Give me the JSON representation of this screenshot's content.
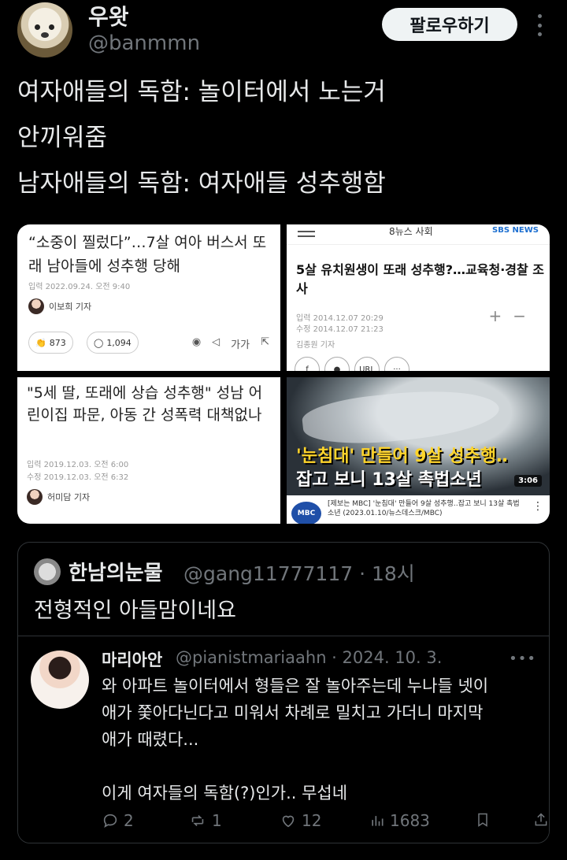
{
  "tweet": {
    "author_name": "우왓",
    "author_handle": "@banmmn",
    "follow_label": "팔로우하기",
    "lines": [
      "여자애들의 독함: 놀이터에서 노는거",
      "안끼워줌",
      "남자애들의 독함: 여자애들 성추행함"
    ]
  },
  "media": {
    "tile1": {
      "headline": "“소중이 찔렀다”…7살 여아 버스서 또래 남아들에 성추행 당해",
      "date": "입력 2022.09.24. 오전 9:40",
      "reporter": "이보희 기자",
      "reactions": "873",
      "comments": "1,094",
      "font_label": "가가"
    },
    "tile2": {
      "section": "8뉴스  사회",
      "logo": "SBS NEWS",
      "headline": "5살 유치원생이 또래 성추행?…교육청·경찰 조사",
      "date_input": "입력 2014.12.07 20:29",
      "date_modified": "수정 2014.12.07 21:23",
      "reporter": "김종원 기자",
      "share_url": "URL"
    },
    "tile3": {
      "headline": "\"5세 딸, 또래에 상습 성추행\" 성남 어린이집 파문, 아동 간 성폭력 대책없나",
      "date_input": "입력 2019.12.03. 오전 6:00",
      "date_modified": "수정 2019.12.03. 오전 6:32",
      "reporter": "허미담 기자"
    },
    "tile4": {
      "caption_line1": "'눈침대' 만들어 9살 성추행‥",
      "caption_line2": "잡고 보니 13살 촉법소년",
      "duration": "3:06",
      "channel": "MBC",
      "strip_text": "[제보는 MBC] '눈침대' 만들어 9살 성추행‥잡고 보니 13살 촉법소년 (2023.01.10/뉴스데스크/MBC)"
    }
  },
  "quote": {
    "author_name": "한남의눈물",
    "meta": "@gang11777117 · 18시",
    "text": "전형적인 아들맘이네요",
    "inner": {
      "author_name": "마리아안",
      "meta": "@pianistmariaahn · 2024. 10. 3.",
      "lines": [
        "와 아파트 놀이터에서 형들은 잘 놀아주는데 누나들 넷이",
        "애가 쫓아다닌다고 미워서 차례로 밀치고 가더니 마지막",
        "애가 때렸다...",
        "",
        "이게 여자들의 독함(?)인가.. 무섭네"
      ],
      "replies": "2",
      "reposts": "1",
      "likes": "12",
      "views": "1683"
    }
  }
}
